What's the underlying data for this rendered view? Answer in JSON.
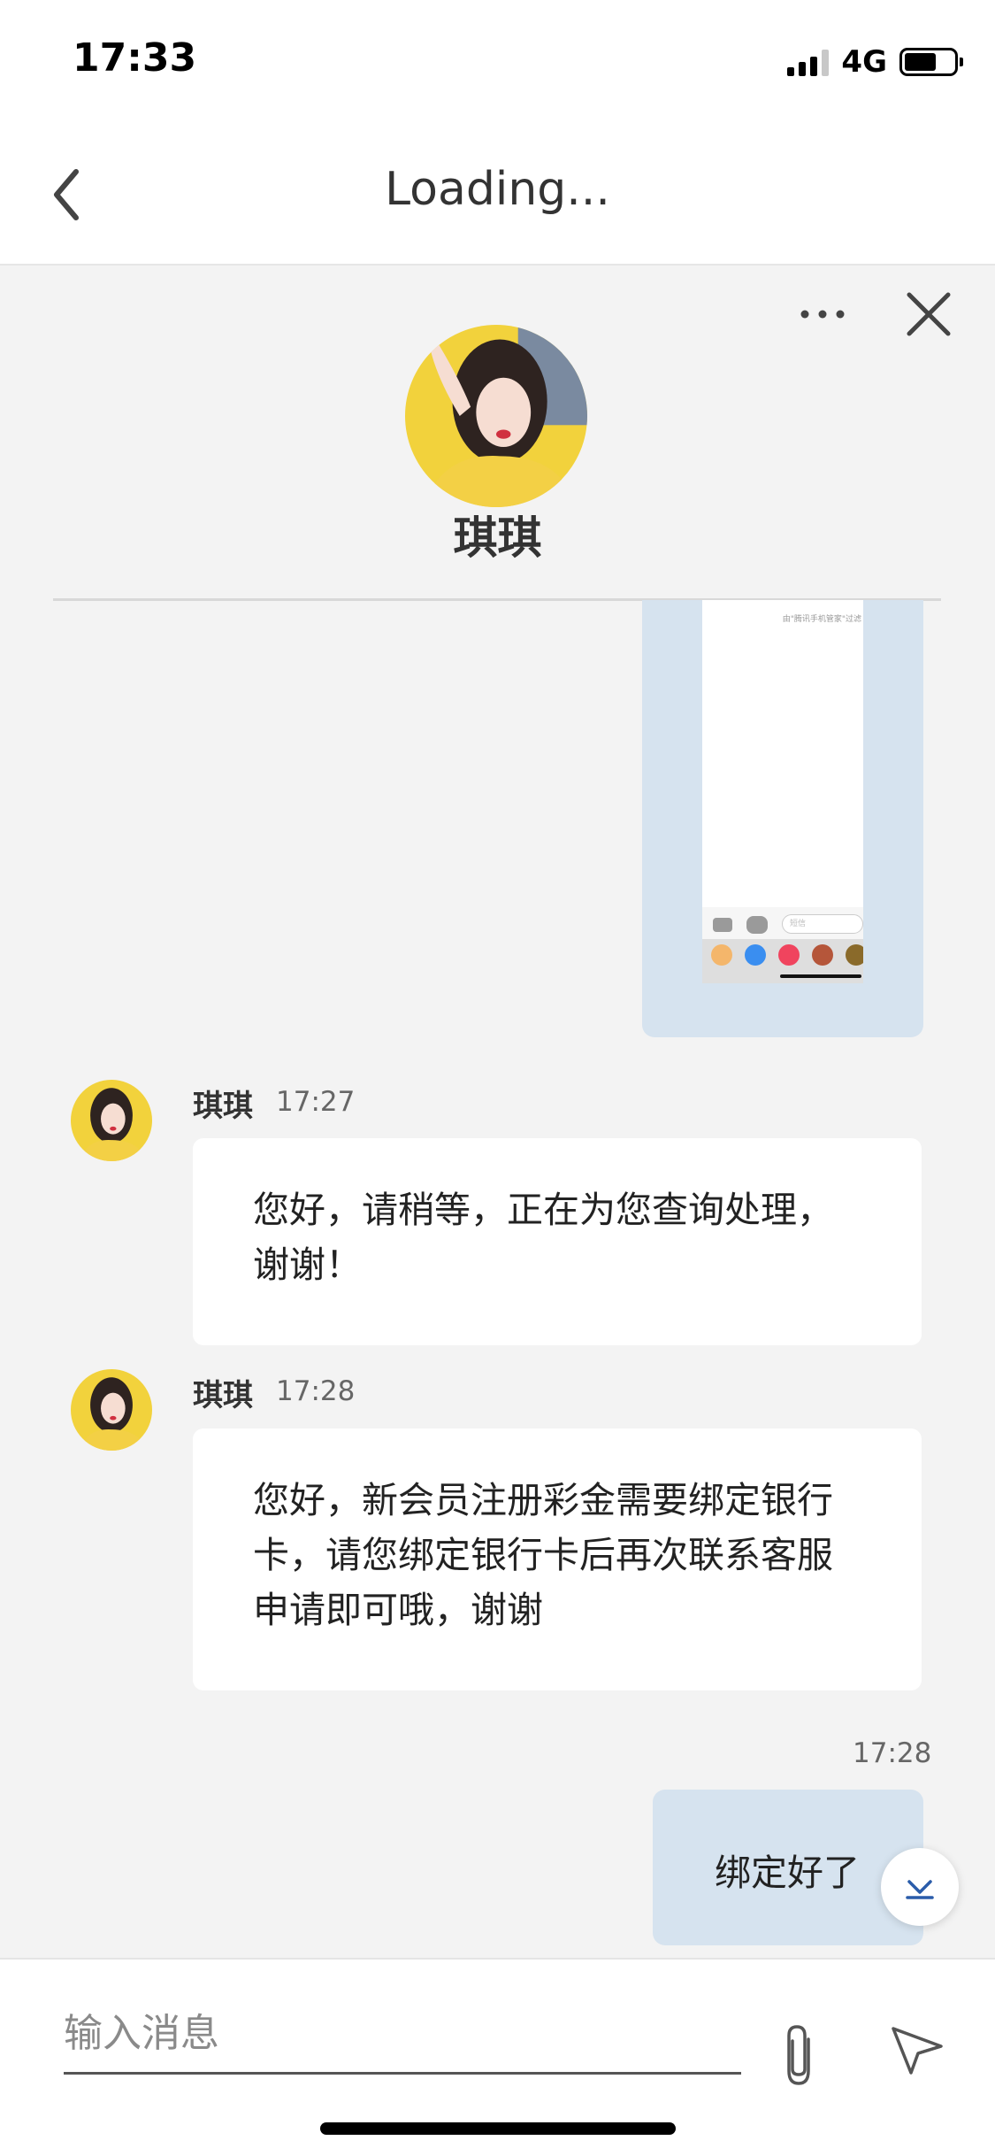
{
  "status_bar": {
    "time": "17:33",
    "network": "4G"
  },
  "nav": {
    "title": "Loading..."
  },
  "agent": {
    "name": "琪琪"
  },
  "composer": {
    "placeholder": "输入消息"
  },
  "messages": [
    {
      "sender": "琪琪",
      "time": "17:27",
      "text_lines": [
        "您好，请稍等，正在为您查询处理，",
        "谢谢！"
      ]
    },
    {
      "sender": "琪琪",
      "time": "17:28",
      "text_lines": [
        "您好，新会员注册彩金需要绑定银行",
        "卡，请您绑定银行卡后再次联系客服",
        "申请即可哦，谢谢"
      ]
    },
    {
      "time": "17:28",
      "text": "绑定好了"
    }
  ],
  "image_message": {
    "hint": "由\"腾讯手机管家\"过滤",
    "input_placeholder": "短信"
  },
  "colors": {
    "outgoing_bubble": "#d6e3ef",
    "incoming_bubble": "#ffffff",
    "background": "#f3f3f3",
    "avatar_shirt": "#f2d23c"
  }
}
